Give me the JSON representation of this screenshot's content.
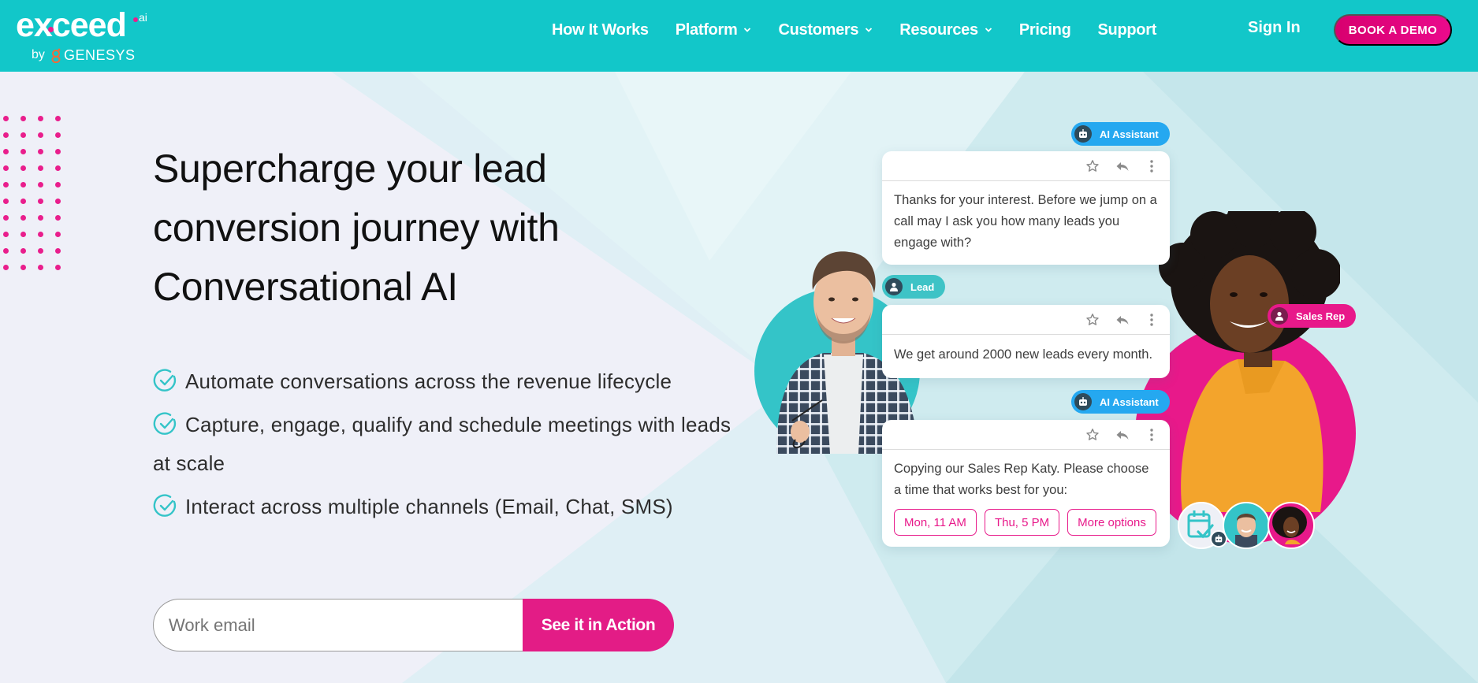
{
  "brand": {
    "name": "exceed",
    "suffix": "ai",
    "by": "by",
    "parent": "GENESYS",
    "colors": {
      "teal": "#12c7c9",
      "pink": "#e31c86",
      "blue": "#25a8f0",
      "dark": "#2f4b5a"
    }
  },
  "nav": {
    "items": [
      {
        "label": "How It Works",
        "dropdown": false
      },
      {
        "label": "Platform",
        "dropdown": true
      },
      {
        "label": "Customers",
        "dropdown": true
      },
      {
        "label": "Resources",
        "dropdown": true
      },
      {
        "label": "Pricing",
        "dropdown": false
      },
      {
        "label": "Support",
        "dropdown": false
      }
    ],
    "sign_in": "Sign In",
    "book_demo": "BOOK A DEMO"
  },
  "hero": {
    "title": "Supercharge your lead conversion journey with Conversational AI",
    "bullets": [
      "Automate conversations across the revenue lifecycle",
      "Capture, engage, qualify and schedule meetings with leads at scale",
      "Interact across multiple channels (Email, Chat, SMS)"
    ],
    "email_placeholder": "Work email",
    "cta": "See it in Action"
  },
  "conversation": {
    "tags": {
      "ai": "AI Assistant",
      "lead": "Lead",
      "sales": "Sales Rep"
    },
    "messages": [
      {
        "from": "AI Assistant",
        "text": "Thanks for your interest. Before we jump on a call may I ask you how many leads you engage with?"
      },
      {
        "from": "Lead",
        "text": "We get around 2000 new leads every month."
      },
      {
        "from": "AI Assistant",
        "text": "Copying our Sales Rep Katy. Please choose a time that works best for you:"
      }
    ],
    "time_options": [
      "Mon, 11 AM",
      "Thu, 5 PM",
      "More options"
    ],
    "toolbar_icons": [
      "star-icon",
      "reply-icon",
      "more-vertical-icon"
    ]
  }
}
